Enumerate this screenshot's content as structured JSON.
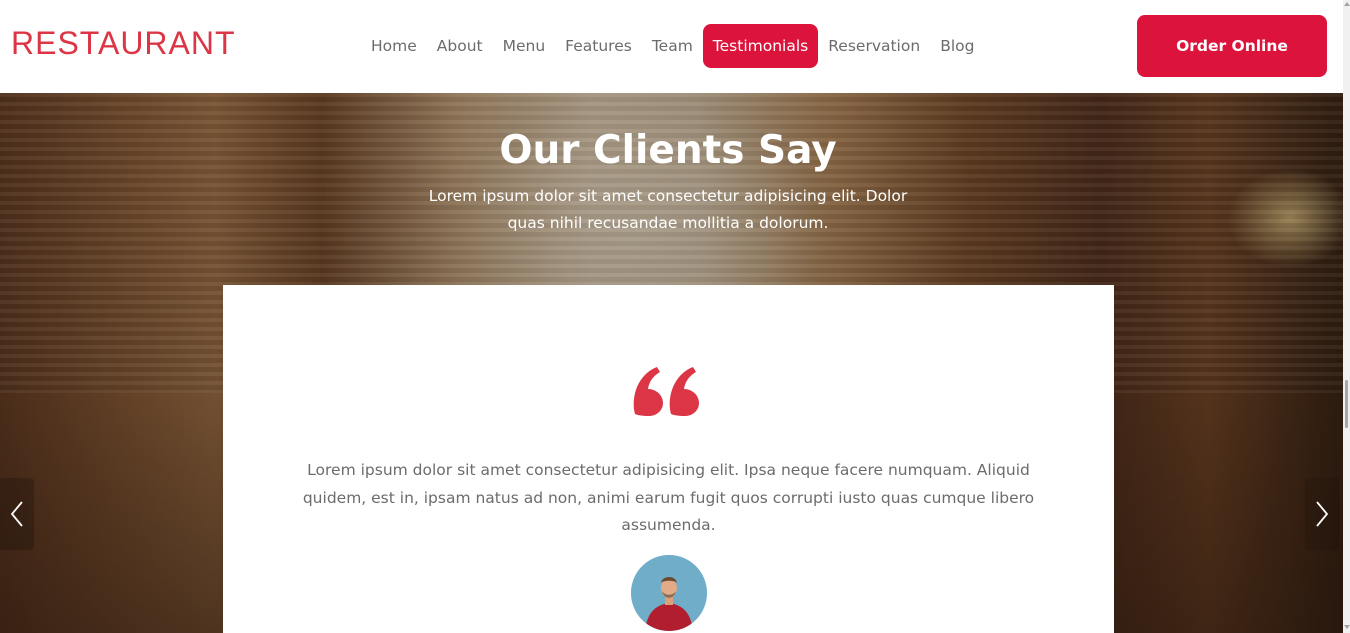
{
  "header": {
    "logo": "RESTAURANT",
    "nav": [
      {
        "label": "Home",
        "active": false
      },
      {
        "label": "About",
        "active": false
      },
      {
        "label": "Menu",
        "active": false
      },
      {
        "label": "Features",
        "active": false
      },
      {
        "label": "Team",
        "active": false
      },
      {
        "label": "Testimonials",
        "active": true
      },
      {
        "label": "Reservation",
        "active": false
      },
      {
        "label": "Blog",
        "active": false
      }
    ],
    "order_button": "Order Online"
  },
  "testimonials": {
    "title": "Our Clients Say",
    "subtitle": "Lorem ipsum dolor sit amet consectetur adipisicing elit. Dolor quas nihil recusandae mollitia a dolorum.",
    "quote_icon": "quote-icon",
    "text": "Lorem ipsum dolor sit amet consectetur adipisicing elit. Ipsa neque facere numquam. Aliquid quidem, est in, ipsam natus ad non, animi earum fugit quos corrupti iusto quas cumque libero assumenda.",
    "prev_icon": "chevron-left-icon",
    "next_icon": "chevron-right-icon"
  },
  "colors": {
    "accent": "#dc143c",
    "logo": "#dc3545",
    "text_muted": "#6c6c6c"
  }
}
